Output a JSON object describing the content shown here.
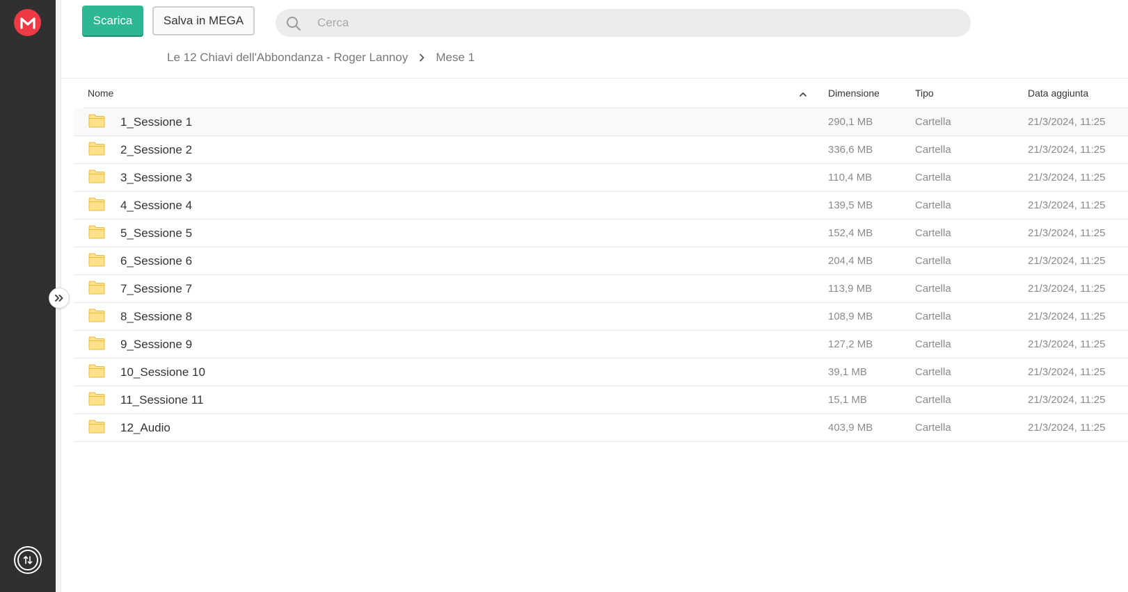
{
  "sidebar": {
    "logo_icon": "mega-logo-icon",
    "logo_color": "#ee3a45",
    "transfer_icon": "transfer-arrows-icon",
    "expand_icon": "double-chevron-right-icon"
  },
  "toolbar": {
    "download_label": "Scarica",
    "save_label": "Salva in MEGA",
    "accent": "#2bb893"
  },
  "search": {
    "placeholder": "Cerca",
    "value": ""
  },
  "breadcrumb": {
    "items": [
      "Le 12 Chiavi dell'Abbondanza - Roger Lannoy",
      "Mese 1"
    ]
  },
  "table": {
    "headers": {
      "name": "Nome",
      "size": "Dimensione",
      "type": "Tipo",
      "date": "Data aggiunta"
    },
    "sort_icon": "chevron-up-icon",
    "rows": [
      {
        "name": "1_Sessione 1",
        "size": "290,1 MB",
        "type": "Cartella",
        "date": "21/3/2024, 11:25"
      },
      {
        "name": "2_Sessione 2",
        "size": "336,6 MB",
        "type": "Cartella",
        "date": "21/3/2024, 11:25"
      },
      {
        "name": "3_Sessione 3",
        "size": "110,4 MB",
        "type": "Cartella",
        "date": "21/3/2024, 11:25"
      },
      {
        "name": "4_Sessione 4",
        "size": "139,5 MB",
        "type": "Cartella",
        "date": "21/3/2024, 11:25"
      },
      {
        "name": "5_Sessione 5",
        "size": "152,4 MB",
        "type": "Cartella",
        "date": "21/3/2024, 11:25"
      },
      {
        "name": "6_Sessione 6",
        "size": "204,4 MB",
        "type": "Cartella",
        "date": "21/3/2024, 11:25"
      },
      {
        "name": "7_Sessione 7",
        "size": "113,9 MB",
        "type": "Cartella",
        "date": "21/3/2024, 11:25"
      },
      {
        "name": "8_Sessione 8",
        "size": "108,9 MB",
        "type": "Cartella",
        "date": "21/3/2024, 11:25"
      },
      {
        "name": "9_Sessione 9",
        "size": "127,2 MB",
        "type": "Cartella",
        "date": "21/3/2024, 11:25"
      },
      {
        "name": "10_Sessione 10",
        "size": "39,1 MB",
        "type": "Cartella",
        "date": "21/3/2024, 11:25"
      },
      {
        "name": "11_Sessione 11",
        "size": "15,1 MB",
        "type": "Cartella",
        "date": "21/3/2024, 11:25"
      },
      {
        "name": "12_Audio",
        "size": "403,9 MB",
        "type": "Cartella",
        "date": "21/3/2024, 11:25"
      }
    ]
  }
}
